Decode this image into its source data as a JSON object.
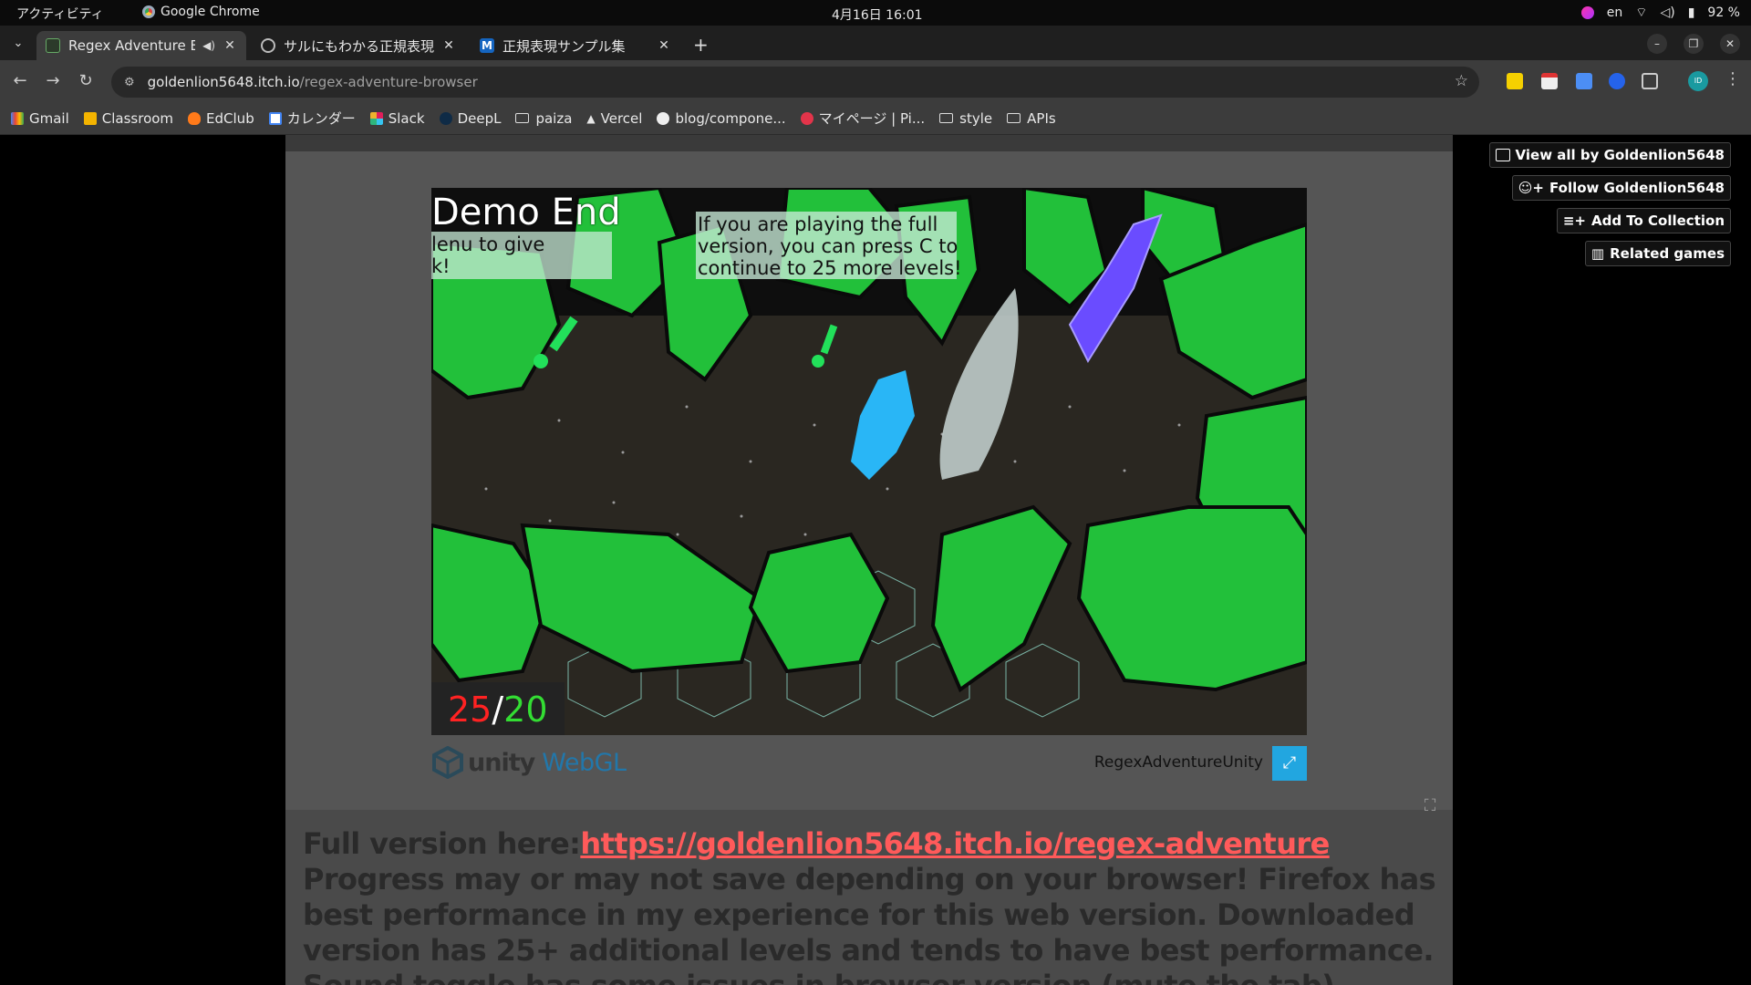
{
  "system": {
    "activities": "アクティビティ",
    "app_name": "Google Chrome",
    "clock": "4月16日  16:01",
    "lang": "en",
    "battery": "92 %"
  },
  "tabs": [
    {
      "title": "Regex Adventure Bro",
      "active": true
    },
    {
      "title": "サルにもわかる正規表現",
      "active": false
    },
    {
      "title": "正規表現サンプル集",
      "active": false
    }
  ],
  "omnibox": {
    "host": "goldenlion5648.itch.io",
    "path": "/regex-adventure-browser"
  },
  "bookmarks": [
    {
      "label": "Gmail",
      "icon": "gmail-icon"
    },
    {
      "label": "Classroom",
      "icon": "classroom-icon"
    },
    {
      "label": "EdClub",
      "icon": "edclub-icon"
    },
    {
      "label": "カレンダー",
      "icon": "calendar-icon"
    },
    {
      "label": "Slack",
      "icon": "slack-icon"
    },
    {
      "label": "DeepL",
      "icon": "deepl-icon"
    },
    {
      "label": "paiza",
      "icon": "folder-icon"
    },
    {
      "label": "Vercel",
      "icon": "vercel-icon"
    },
    {
      "label": "blog/compone...",
      "icon": "github-icon"
    },
    {
      "label": "マイページ | Pi...",
      "icon": "pixiv-icon"
    },
    {
      "label": "style",
      "icon": "folder-icon"
    },
    {
      "label": "APIs",
      "icon": "folder-icon"
    }
  ],
  "game": {
    "demo_end": "Demo End",
    "left_panel": "lenu to give\nk!",
    "right_panel": "If you are playing the full\nversion, you can press C to\ncontinue to 25 more levels!",
    "score_current": "25",
    "score_slash": "/",
    "score_total": "20",
    "unity_word": "unity",
    "webgl_word": "WebGL",
    "title": "RegexAdventureUnity",
    "colors": {
      "leaf": "#22c03a",
      "player": "#29b6f6",
      "crystal": "#6a4cff",
      "bg": "#2a2721"
    }
  },
  "side_buttons": [
    {
      "label": "View all by Goldenlion5648",
      "icon": "store-icon"
    },
    {
      "label": "Follow Goldenlion5648",
      "icon": "follow-icon"
    },
    {
      "label": "Add To Collection",
      "icon": "collection-icon"
    },
    {
      "label": "Related games",
      "icon": "map-icon"
    }
  ],
  "description": {
    "lead": "Full version here:",
    "link": "https://goldenlion5648.itch.io/regex-adventure",
    "rest": " Progress may or may not save depending on your browser! Firefox has best performance in my experience for this web version. Downloaded version has 25+ additional levels and tends to have best performance. Sound toggle has some issues in browser version (mute the tab)."
  }
}
